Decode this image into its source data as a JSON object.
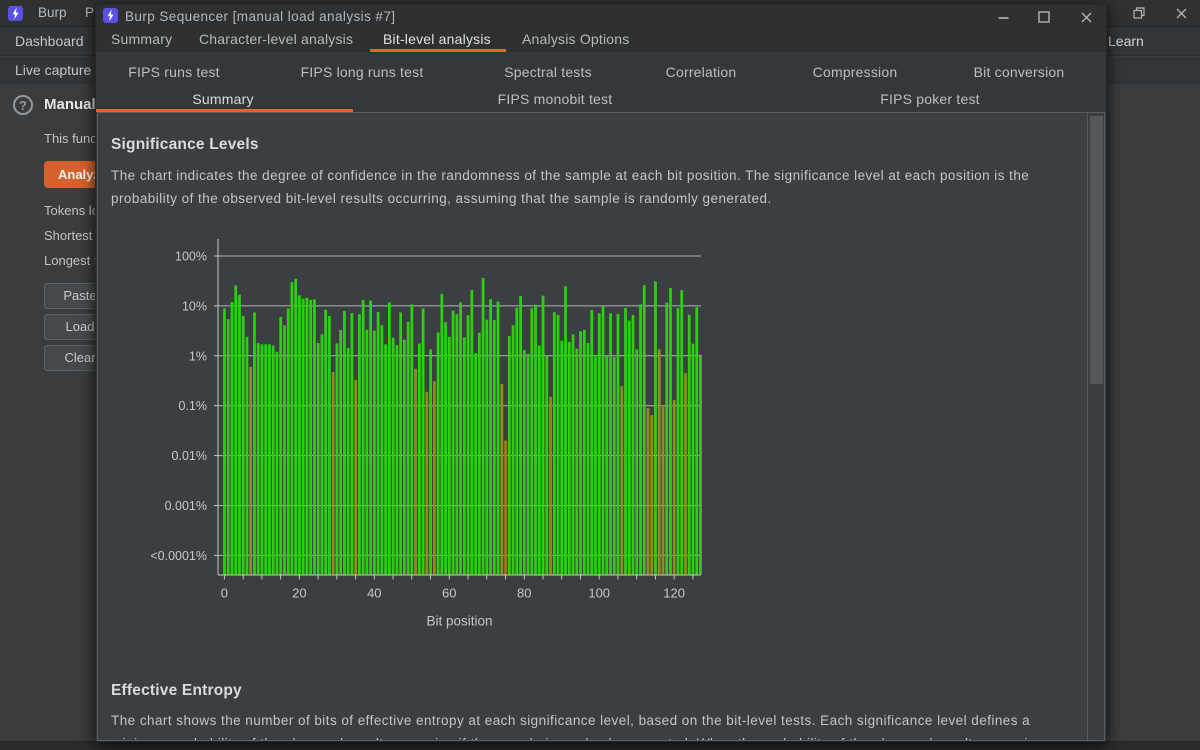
{
  "main_window": {
    "title_left": "Burp",
    "title_partial": "P",
    "tabs": [
      "Dashboard",
      "Learn"
    ],
    "subtabs": [
      "Live capture"
    ]
  },
  "left_panel": {
    "help_glyph": "?",
    "heading": "Manual load",
    "description": "This function",
    "analyze_button": "Analyze now",
    "stats": [
      "Tokens loaded:",
      "Shortest token:",
      "Longest token:"
    ],
    "buttons": [
      "Paste",
      "Load",
      "Clear"
    ]
  },
  "dialog": {
    "title": "Burp Sequencer [manual load analysis #7]",
    "tabs": [
      "Summary",
      "Character-level analysis",
      "Bit-level analysis",
      "Analysis Options"
    ],
    "selected_tab": "Bit-level analysis",
    "subtabs_row1": [
      "FIPS runs test",
      "FIPS long runs test",
      "Spectral tests",
      "Correlation",
      "Compression",
      "Bit conversion"
    ],
    "subtabs_row2": [
      "Summary",
      "FIPS monobit test",
      "FIPS poker test"
    ],
    "selected_subtab": "Summary",
    "accent_color": "#e8622b"
  },
  "content": {
    "section1": {
      "heading": "Significance Levels",
      "lines": [
        "The chart indicates the degree of confidence in the randomness of the sample at each bit position. The significance level at each position is the",
        "probability of the observed bit-level results occurring, assuming that the sample is randomly generated."
      ]
    },
    "section2": {
      "heading": "Effective Entropy",
      "lines": [
        "The chart shows the number of bits of effective entropy at each significance level, based on the bit-level tests. Each significance level defines a",
        "minimum probability of the observed results occurring if the sample is randomly generated. When the probability of the observed results occurring"
      ]
    }
  },
  "chart_data": {
    "type": "bar",
    "title": "Significance Levels",
    "xlabel": "Bit position",
    "ylabel": "",
    "y_scale": "log",
    "y_ticks": [
      {
        "label": "100%",
        "value": 100
      },
      {
        "label": "10%",
        "value": 10
      },
      {
        "label": "1%",
        "value": 1
      },
      {
        "label": "0.1%",
        "value": 0.1
      },
      {
        "label": "0.01%",
        "value": 0.01
      },
      {
        "label": "0.001%",
        "value": 0.001
      },
      {
        "label": "<0.0001%",
        "value": 0.0001
      }
    ],
    "x_ticks": [
      0,
      20,
      40,
      60,
      80,
      100,
      120
    ],
    "categories_note": "bit positions 0-127",
    "values": [
      9,
      5.4,
      12,
      25.6,
      16.8,
      6.3,
      2.4,
      0.6,
      7.4,
      1.8,
      1.7,
      1.7,
      1.7,
      1.6,
      1.2,
      6,
      4.1,
      8.9,
      29.7,
      34.8,
      16.3,
      13.9,
      14.6,
      13.2,
      13.5,
      1.8,
      2.7,
      8.4,
      6.3,
      0.47,
      1.77,
      3.3,
      7.9,
      1.43,
      7.2,
      0.33,
      6.8,
      13.1,
      3.3,
      12.8,
      3.2,
      7.5,
      4.1,
      1.7,
      11.8,
      2.3,
      1.63,
      7.4,
      2.1,
      4.8,
      10.7,
      0.55,
      1.76,
      8.9,
      0.19,
      1.35,
      0.31,
      2.95,
      17.5,
      4.7,
      2.4,
      8.0,
      6.8,
      11.8,
      2.35,
      6.5,
      20.7,
      1.13,
      2.9,
      36.6,
      5.3,
      13.6,
      5.2,
      12.2,
      0.27,
      0.02,
      2.5,
      4.1,
      9.2,
      15.8,
      1.3,
      1.1,
      9.0,
      10.5,
      1.6,
      16,
      1.0,
      0.15,
      7.5,
      6.6,
      2.0,
      24.8,
      1.9,
      2.7,
      1.4,
      3.1,
      3.3,
      1.8,
      8.3,
      0.96,
      7.1,
      9.9,
      0.97,
      7.1,
      0.94,
      6.8,
      0.245,
      9.1,
      5.1,
      6.6,
      1.35,
      10.7,
      26,
      0.09,
      0.065,
      31,
      1.35,
      0.095,
      11.7,
      23,
      0.13,
      9.0,
      20.6,
      0.45,
      6.7,
      1.75,
      9.4,
      1.05
    ],
    "bar_color": "#2bd10f",
    "low_color": "#8f8f1e",
    "very_low_color": "#a8771c",
    "low_threshold": 0.7,
    "very_low_threshold": 0.035,
    "color_overrides": {
      "116": "low_color"
    },
    "ylim": [
      0.0001,
      100
    ],
    "grid": true
  }
}
